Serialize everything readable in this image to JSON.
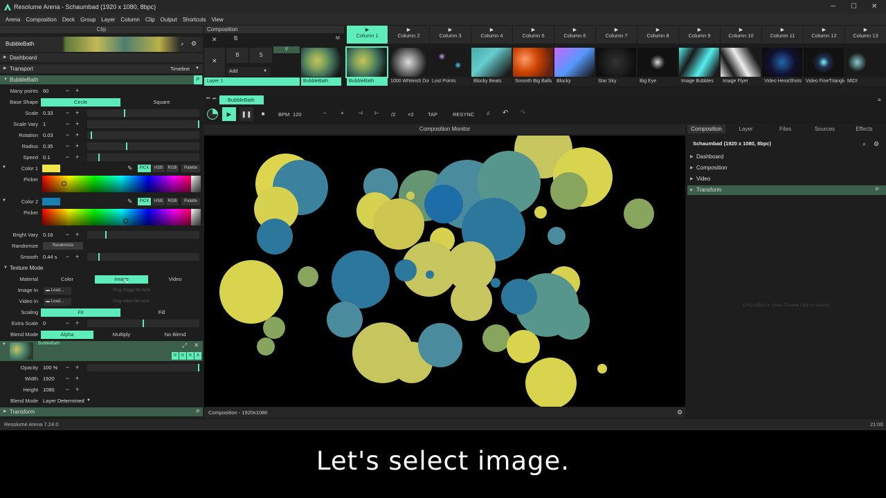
{
  "window": {
    "title": "Resolume Arena - Schaumbad (1920 x 1080, 8bpc)"
  },
  "menu": [
    "Arena",
    "Composition",
    "Deck",
    "Group",
    "Layer",
    "Column",
    "Clip",
    "Output",
    "Shortcuts",
    "View"
  ],
  "clip_panel": {
    "header": "Clip",
    "name_value": "BubbleBath",
    "sections": {
      "dashboard": "Dashboard",
      "transport": "Transport",
      "transport_mode": "Timeline",
      "effect": "BubbleBath",
      "texture_mode": "Texture Mode",
      "transform": "Transform"
    },
    "params": {
      "many_points": {
        "label": "Many points",
        "value": "60"
      },
      "base_shape": {
        "label": "Base Shape",
        "options": [
          "Circle",
          "Square"
        ],
        "selected": "Circle"
      },
      "scale": {
        "label": "Scale",
        "value": "0.33",
        "level": 0.33
      },
      "scale_vary": {
        "label": "Scale Vary",
        "value": "1",
        "level": 1.0
      },
      "rotation": {
        "label": "Rotation",
        "value": "0.03",
        "level": 0.03
      },
      "radius": {
        "label": "Radius",
        "value": "0.35",
        "level": 0.35
      },
      "speed": {
        "label": "Speed",
        "value": "0.1",
        "level": 0.1
      },
      "color1": {
        "label": "Color 1",
        "color": "#f2e54a",
        "picker_label": "Picker"
      },
      "color2": {
        "label": "Color 2",
        "color": "#1a7fb3",
        "picker_label": "Picker"
      },
      "color_modes": [
        "PICK",
        "HSB",
        "RGB",
        "Palette"
      ],
      "bright_vary": {
        "label": "Bright Vary",
        "value": "0.16",
        "level": 0.16
      },
      "randomize": {
        "label": "Randomize",
        "button": "Randomize"
      },
      "smooth": {
        "label": "Smooth",
        "value": "0.44 s",
        "level": 0.1
      },
      "material": {
        "label": "Material",
        "options": [
          "Color",
          "Image",
          "Video"
        ],
        "selected": "Image"
      },
      "image_in": {
        "label": "Image In",
        "button": "Load...",
        "hint": "Drop image file here."
      },
      "video_in": {
        "label": "Video In",
        "button": "Load...",
        "hint": "Drop video file here."
      },
      "scaling": {
        "label": "Scaling",
        "options": [
          "Fit",
          "Fill"
        ],
        "selected": "Fit"
      },
      "extra_scale": {
        "label": "Extra Scale",
        "value": "0",
        "level": 0.5
      },
      "blend_mode": {
        "label": "Blend Mode",
        "options": [
          "Alpha",
          "Multiply",
          "No Blend"
        ],
        "selected": "Alpha"
      }
    },
    "preview": {
      "name": "BubbleBath",
      "channels": [
        "R",
        "G",
        "B",
        "A"
      ]
    },
    "props": {
      "opacity": {
        "label": "Opacity",
        "value": "100 %",
        "level": 1.0
      },
      "width": {
        "label": "Width",
        "value": "1920"
      },
      "height": {
        "label": "Height",
        "value": "1080"
      },
      "blend_mode": {
        "label": "Blend Mode",
        "value": "Layer Determined"
      }
    }
  },
  "deck": {
    "header": "Composition",
    "controls": {
      "b": "B",
      "s": "S",
      "m": "M",
      "v": "V",
      "add": "Add"
    },
    "layer": "Layer 1",
    "layer_clip": "BubbleBath",
    "columns": [
      "Column 1",
      "Column 2",
      "Column 3",
      "Column 4",
      "Column 5",
      "Column 6",
      "Column 7",
      "Column 8",
      "Column 9",
      "Column 10",
      "Column 11",
      "Column 12",
      "Column 13"
    ],
    "clips": [
      "BubbleBath",
      "1000 Whiteish Dots",
      "Lost Points",
      "Blocky Beats",
      "Smooth Big Balls",
      "Blocky",
      "Star Sky",
      "Big Eye",
      "Image Bubbles",
      "Image Flyer",
      "Video HexaShots",
      "Video FineTriangles",
      "MIDI"
    ],
    "active_column": 0
  },
  "transport": {
    "clip_tab": "BubbleBath",
    "bpm_label": "BPM",
    "bpm_value": "120",
    "buttons": {
      "minus": "−",
      "plus": "+",
      "half": "/2",
      "double": "×2",
      "tap": "TAP",
      "resync": "RESYNC"
    }
  },
  "monitor": {
    "header": "Composition Monitor",
    "footer": "Composition - 1920x1080"
  },
  "right_panel": {
    "tabs": [
      "Composition",
      "Layer",
      "Files",
      "Sources",
      "Effects"
    ],
    "active_tab": "Composition",
    "title": "Schaumbad (1920 x 1080, 8bpc)",
    "items": [
      "Dashboard",
      "Composition",
      "Video",
      "Transform"
    ],
    "drop_hint": "Drop effect or mixer. Double click to search."
  },
  "status": {
    "version": "Resolume Arena 7.24.0",
    "time": "21:00"
  },
  "subtitle": "Let's select image.",
  "colors": {
    "accent": "#5eedb8",
    "section_green": "#3b5f4a"
  }
}
